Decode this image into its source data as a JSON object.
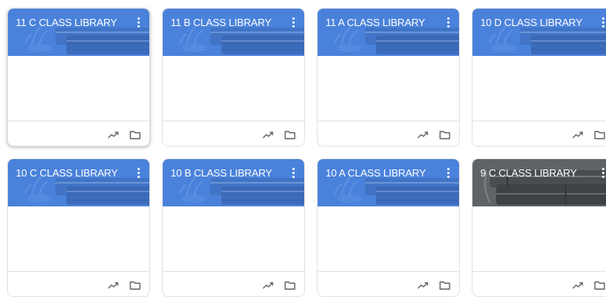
{
  "colors": {
    "header_blue": "#4a82db",
    "header_grey": "#5f6368",
    "icon_grey": "#5f6368",
    "border": "#e3e3e3"
  },
  "icons": {
    "menu": "more-vert-icon",
    "trend": "trending-up-icon",
    "folder": "folder-icon"
  },
  "classes": [
    {
      "title": "11 C CLASS LIBRARY",
      "theme": "blue"
    },
    {
      "title": "11 B CLASS LIBRARY",
      "theme": "blue"
    },
    {
      "title": "11 A CLASS LIBRARY",
      "theme": "blue"
    },
    {
      "title": "10 D CLASS LIBRARY",
      "theme": "blue"
    },
    {
      "title": "10 C CLASS LIBRARY",
      "theme": "blue"
    },
    {
      "title": "10 B CLASS LIBRARY",
      "theme": "blue"
    },
    {
      "title": "10 A CLASS LIBRARY",
      "theme": "blue"
    },
    {
      "title": "9 C CLASS LIBRARY",
      "theme": "grey"
    }
  ]
}
